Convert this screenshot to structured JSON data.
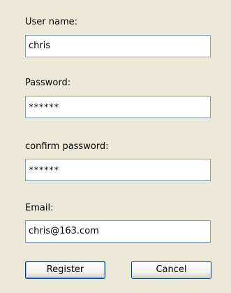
{
  "form": {
    "username_label": "User name:",
    "username_value": "chris",
    "password_label": "Password:",
    "password_value": "******",
    "confirm_label": "confirm password:",
    "confirm_value": "******",
    "email_label": "Email:",
    "email_value": "chris@163.com"
  },
  "buttons": {
    "register": "Register",
    "cancel": "Cancel"
  },
  "colors": {
    "background": "#ece9d8",
    "field_border": "#7f9db9",
    "button_border": "#003c74"
  }
}
